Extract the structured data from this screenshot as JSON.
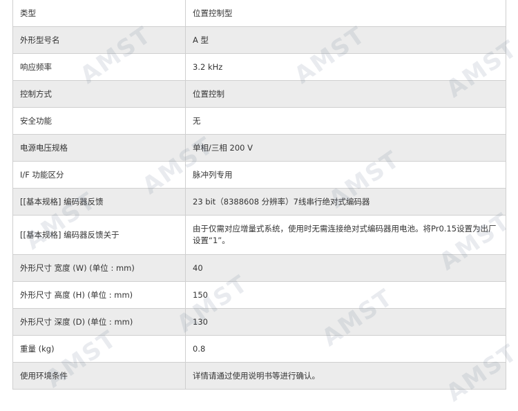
{
  "rows": [
    {
      "label": "类型",
      "value": "位置控制型"
    },
    {
      "label": "外形型号名",
      "value": "A 型"
    },
    {
      "label": "响应频率",
      "value": "3.2 kHz"
    },
    {
      "label": "控制方式",
      "value": "位置控制"
    },
    {
      "label": "安全功能",
      "value": "无"
    },
    {
      "label": "电源电压规格",
      "value": "单相/三相 200 V"
    },
    {
      "label": "I/F 功能区分",
      "value": "脉冲列专用"
    },
    {
      "label": "[[基本规格] 编码器反馈",
      "value": "23 bit（8388608 分辨率）7线串行绝对式编码器"
    },
    {
      "label": "[[基本规格] 编码器反馈关于",
      "value": "由于仅需对应增量式系统，使用时无需连接绝对式编码器用电池。将Pr0.15设置为出厂设置“1”。"
    },
    {
      "label": "外形尺寸 宽度 (W) (单位 : mm)",
      "value": "40"
    },
    {
      "label": "外形尺寸 高度 (H) (单位 : mm)",
      "value": "150"
    },
    {
      "label": "外形尺寸 深度 (D) (单位 : mm)",
      "value": "130"
    },
    {
      "label": "重量 (kg)",
      "value": "0.8"
    },
    {
      "label": "使用环境条件",
      "value": "详情请通过使用说明书等进行确认。"
    }
  ],
  "watermark": {
    "text": "AMST"
  }
}
